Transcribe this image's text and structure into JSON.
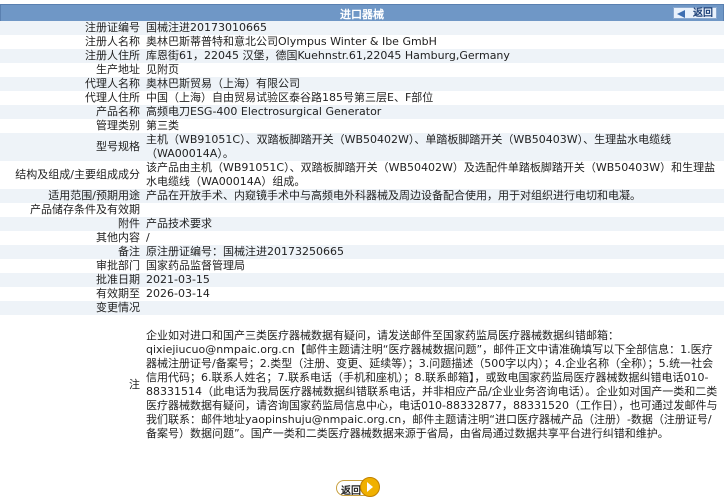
{
  "header": {
    "title": "进口器械",
    "back_label": "返回"
  },
  "rows": [
    {
      "label": "注册证编号",
      "value": "国械注进20173010665"
    },
    {
      "label": "注册人名称",
      "value": "奥林巴斯蒂普特和意北公司Olympus Winter & Ibe GmbH"
    },
    {
      "label": "注册人住所",
      "value": "库恩街61，22045 汉堡，德国Kuehnstr.61,22045 Hamburg,Germany"
    },
    {
      "label": "生产地址",
      "value": "见附页"
    },
    {
      "label": "代理人名称",
      "value": "奥林巴斯贸易（上海）有限公司"
    },
    {
      "label": "代理人住所",
      "value": "中国（上海）自由贸易试验区泰谷路185号第三层E、F部位"
    },
    {
      "label": "产品名称",
      "value": "高频电刀ESG-400 Electrosurgical Generator"
    },
    {
      "label": "管理类别",
      "value": "第三类"
    },
    {
      "label": "型号规格",
      "value": "主机（WB91051C）、双踏板脚踏开关（WB50402W）、单踏板脚踏开关（WB50403W）、生理盐水电缆线（WA00014A）。"
    },
    {
      "label": "结构及组成/主要组成成分",
      "value": "该产品由主机（WB91051C）、双踏板脚踏开关（WB50402W）及选配件单踏板脚踏开关（WB50403W）和生理盐水电缆线（WA00014A）组成。"
    },
    {
      "label": "适用范围/预期用途",
      "value": "产品在开放手术、内窥镜手术中与高频电外科器械及周边设备配合使用，用于对组织进行电切和电凝。"
    },
    {
      "label": "产品储存条件及有效期",
      "value": ""
    },
    {
      "label": "附件",
      "value": "产品技术要求"
    },
    {
      "label": "其他内容",
      "value": "/"
    },
    {
      "label": "备注",
      "value": "原注册证编号：国械注进20173250665"
    },
    {
      "label": "审批部门",
      "value": "国家药品监督管理局"
    },
    {
      "label": "批准日期",
      "value": "2021-03-15"
    },
    {
      "label": "有效期至",
      "value": "2026-03-14"
    },
    {
      "label": "变更情况",
      "value": ""
    },
    {
      "label": "注",
      "value": "企业如对进口和国产三类医疗器械数据有疑问，请发送邮件至国家药监局医疗器械数据纠错邮箱：qixiejiucuo@nmpaic.org.cn【邮件主题请注明“医疗器械数据问题”，邮件正文中请准确填写以下全部信息：1.医疗器械注册证号/备案号；2.类型（注册、变更、延续等）；3.问题描述（500字以内）；4.企业名称（全称）；5.统一社会信用代码；6.联系人姓名；7.联系电话（手机和座机）；8.联系邮箱】，或致电国家药监局医疗器械数据纠错电话010-88331514（此电话为我局医疗器械数据纠错联系电话，并非相应产品/企业业务咨询电话）。企业如对国产一类和二类医疗器械数据有疑问，请咨询国家药监局信息中心，电话010-88332877，88331520（工作日），也可通过发邮件与我们联系：邮件地址yaopinshuju@nmpaic.org.cn，邮件主题请注明“进口医疗器械产品（注册）-数据（注册证号/备案号）数据问题”。国产一类和二类医疗器械数据来源于省局，由省局通过数据共享平台进行纠错和维护。"
    }
  ],
  "footer": {
    "back_label": "返回"
  }
}
